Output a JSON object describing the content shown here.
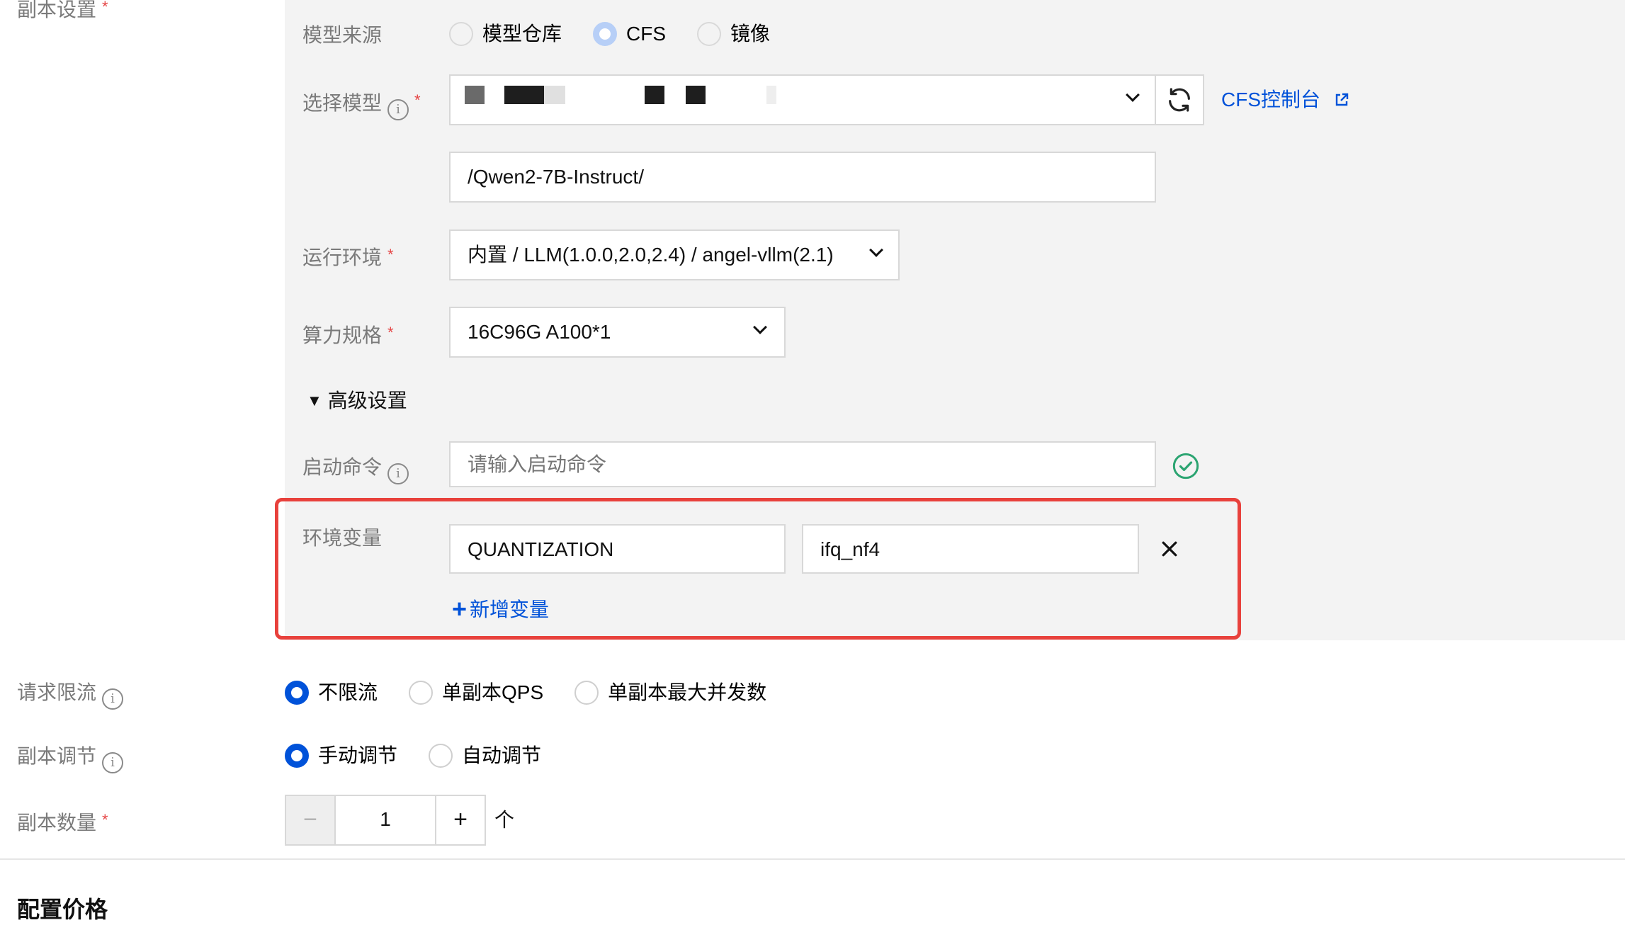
{
  "section": {
    "replica_settings_label": "副本设置",
    "price_heading": "配置价格"
  },
  "model_source": {
    "label": "模型来源",
    "options": [
      "模型仓库",
      "CFS",
      "镜像"
    ],
    "selected": "CFS"
  },
  "select_model": {
    "label": "选择模型",
    "selected_value": "",
    "cfs_console_link": "CFS控制台",
    "path_value": "/Qwen2-7B-Instruct/"
  },
  "runtime_env": {
    "label": "运行环境",
    "value": "内置 / LLM(1.0.0,2.0,2.4) / angel-vllm(2.1)"
  },
  "compute_spec": {
    "label": "算力规格",
    "value": "16C96G A100*1"
  },
  "advanced": {
    "toggle_label": "高级设置",
    "start_command": {
      "label": "启动命令",
      "placeholder": "请输入启动命令",
      "value": ""
    },
    "env_vars": {
      "label": "环境变量",
      "rows": [
        {
          "key": "QUANTIZATION",
          "value": "ifq_nf4"
        }
      ],
      "add_label": "新增变量"
    }
  },
  "rate_limit": {
    "label": "请求限流",
    "options": [
      "不限流",
      "单副本QPS",
      "单副本最大并发数"
    ],
    "selected": "不限流"
  },
  "replica_adjust": {
    "label": "副本调节",
    "options": [
      "手动调节",
      "自动调节"
    ],
    "selected": "手动调节"
  },
  "replica_count": {
    "label": "副本数量",
    "value": "1",
    "unit": "个",
    "minus": "−",
    "plus": "+"
  },
  "colors": {
    "accent": "#0052d9",
    "required": "#e54545",
    "highlight_border": "#e8413c",
    "success": "#2ba471",
    "panel_bg": "#f3f3f3"
  }
}
